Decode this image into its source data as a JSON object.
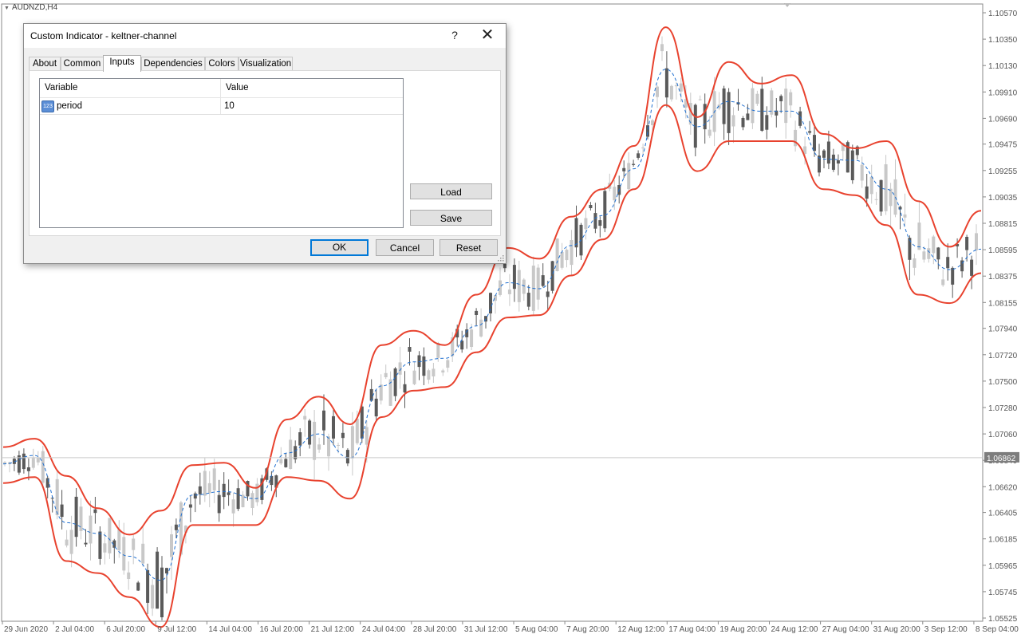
{
  "chart": {
    "symbol_label": "AUDNZD,H4",
    "current_price": "1.06862",
    "price_ticks": [
      "1.10570",
      "1.10350",
      "1.10130",
      "1.09910",
      "1.09690",
      "1.09475",
      "1.09255",
      "1.09035",
      "1.08815",
      "1.08595",
      "1.08375",
      "1.08155",
      "1.07940",
      "1.07720",
      "1.07500",
      "1.07280",
      "1.07060",
      "1.06840",
      "1.06620",
      "1.06405",
      "1.06185",
      "1.05965",
      "1.05745",
      "1.05525"
    ],
    "time_ticks": [
      "29 Jun 2020",
      "2 Jul 04:00",
      "6 Jul 20:00",
      "9 Jul 12:00",
      "14 Jul 04:00",
      "16 Jul 20:00",
      "21 Jul 12:00",
      "24 Jul 04:00",
      "28 Jul 20:00",
      "31 Jul 12:00",
      "5 Aug 04:00",
      "7 Aug 20:00",
      "12 Aug 12:00",
      "17 Aug 04:00",
      "19 Aug 20:00",
      "24 Aug 12:00",
      "27 Aug 04:00",
      "31 Aug 20:00",
      "3 Sep 12:00",
      "8 Sep 04:00"
    ],
    "colors": {
      "band": "#e8422e",
      "mid": "#1f6fd0",
      "bull": "#c8c8c8",
      "bear": "#5a5a5a",
      "grid": "#c9c9c9",
      "axis_text": "#555555",
      "price_box": "#7d7d7d"
    }
  },
  "dialog": {
    "title": "Custom Indicator - keltner-channel",
    "help_label": "?",
    "close_label": "✕",
    "tabs": [
      "About",
      "Common",
      "Inputs",
      "Dependencies",
      "Colors",
      "Visualization"
    ],
    "active_tab": "Inputs",
    "table": {
      "headers": [
        "Variable",
        "Value"
      ],
      "rows": [
        {
          "icon": "numeric-variable-icon",
          "icon_text": "123",
          "variable": "period",
          "value": "10"
        }
      ]
    },
    "buttons": {
      "load": "Load",
      "save": "Save",
      "ok": "OK",
      "cancel": "Cancel",
      "reset": "Reset"
    }
  },
  "chart_data": {
    "type": "candlestick",
    "title": "AUDNZD,H4",
    "indicator": "keltner-channel",
    "ylim": [
      1.05525,
      1.1057
    ],
    "current_price": 1.06862,
    "x_labels": [
      "29 Jun 2020",
      "2 Jul 04:00",
      "6 Jul 20:00",
      "9 Jul 12:00",
      "14 Jul 04:00",
      "16 Jul 20:00",
      "21 Jul 12:00",
      "24 Jul 04:00",
      "28 Jul 20:00",
      "31 Jul 12:00",
      "5 Aug 04:00",
      "7 Aug 20:00",
      "12 Aug 12:00",
      "17 Aug 04:00",
      "19 Aug 20:00",
      "24 Aug 12:00",
      "27 Aug 04:00",
      "31 Aug 20:00",
      "3 Sep 12:00",
      "8 Sep 04:00"
    ],
    "series": [
      {
        "name": "Keltner upper",
        "values": [
          1.0695,
          1.0702,
          1.0671,
          1.0644,
          1.0622,
          1.0642,
          1.068,
          1.0682,
          1.0661,
          1.0718,
          1.0737,
          1.0714,
          1.078,
          1.0792,
          1.078,
          1.0822,
          1.0861,
          1.0852,
          1.0887,
          1.091,
          1.0946,
          1.1045,
          1.097,
          1.1016,
          1.0998,
          1.1005,
          1.0956,
          1.0944,
          1.095,
          1.09,
          1.0862,
          1.0892
        ]
      },
      {
        "name": "Keltner middle",
        "values": [
          1.0681,
          1.0688,
          1.0632,
          1.0623,
          1.0604,
          1.0584,
          1.0655,
          1.0658,
          1.0652,
          1.069,
          1.0706,
          1.0686,
          1.0746,
          1.0766,
          1.0769,
          1.0796,
          1.0832,
          1.0827,
          1.0863,
          1.0888,
          1.0927,
          1.101,
          1.0962,
          1.0983,
          1.0975,
          1.0975,
          1.0935,
          1.0934,
          1.091,
          1.0862,
          1.0843,
          1.086
        ]
      },
      {
        "name": "Keltner lower",
        "values": [
          1.0665,
          1.067,
          1.06,
          1.059,
          1.057,
          1.0545,
          1.063,
          1.063,
          1.063,
          1.067,
          1.0667,
          1.0652,
          1.072,
          1.0742,
          1.0745,
          1.0774,
          1.0803,
          1.0805,
          1.0838,
          1.0868,
          1.091,
          1.098,
          1.0925,
          1.095,
          1.095,
          1.095,
          1.091,
          1.0905,
          1.088,
          1.0822,
          1.0815,
          1.084
        ]
      }
    ]
  }
}
